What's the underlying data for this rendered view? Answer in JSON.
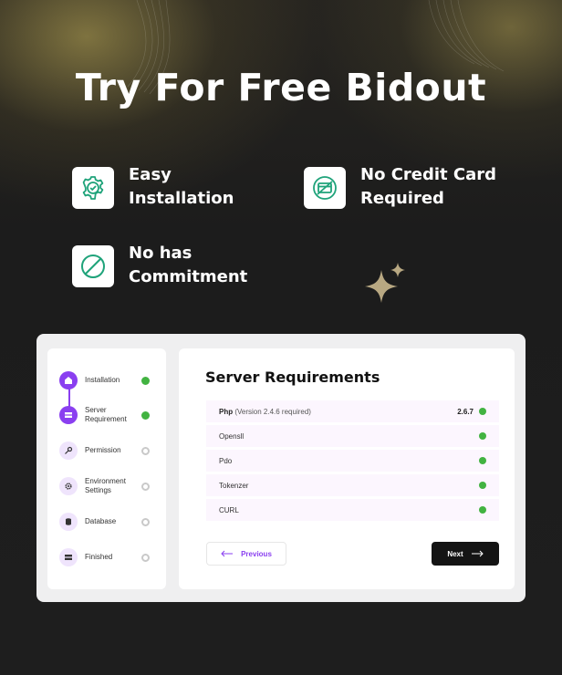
{
  "hero": {
    "title": "Try For Free Bidout"
  },
  "features": [
    {
      "icon": "gear-check-icon",
      "label": "Easy\nInstallation"
    },
    {
      "icon": "credit-card-icon",
      "label": "No Credit Card\nRequired"
    },
    {
      "icon": "no-commitment-icon",
      "label": "No has\nCommitment"
    }
  ],
  "wizard": {
    "steps": [
      {
        "label": "Installation",
        "icon": "home-icon",
        "state": "done"
      },
      {
        "label": "Server\nRequirement",
        "icon": "server-icon",
        "state": "done"
      },
      {
        "label": "Permission",
        "icon": "key-icon",
        "state": "pending"
      },
      {
        "label": "Environment\nSettings",
        "icon": "gear-icon",
        "state": "pending"
      },
      {
        "label": "Database",
        "icon": "database-icon",
        "state": "pending"
      },
      {
        "label": "Finished",
        "icon": "flag-icon",
        "state": "pending"
      }
    ],
    "title": "Server Requirements",
    "requirements": [
      {
        "name": "Php",
        "note": "(Version 2.4.6 required)",
        "version": "2.6.7"
      },
      {
        "name": "Opensll",
        "note": "",
        "version": ""
      },
      {
        "name": "Pdo",
        "note": "",
        "version": ""
      },
      {
        "name": "Tokenzer",
        "note": "",
        "version": ""
      },
      {
        "name": "CURL",
        "note": "",
        "version": ""
      }
    ],
    "previous_label": "Previous",
    "next_label": "Next"
  },
  "colors": {
    "accent": "#8a3ff0",
    "success": "#42b341",
    "feature_icon": "#1fa37a",
    "background": "#1f1f1f"
  }
}
